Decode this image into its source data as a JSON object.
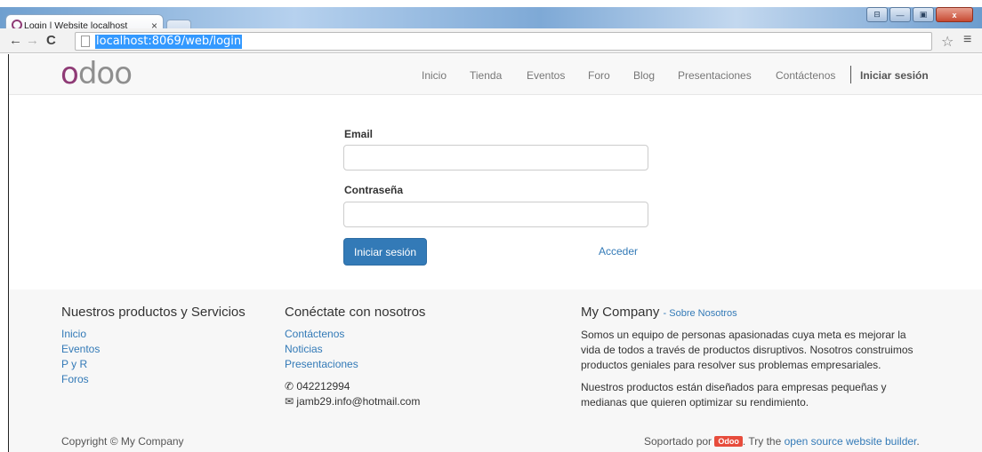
{
  "browser": {
    "tab_title": "Login | Website localhost",
    "tab_close": "×",
    "url": "localhost:8069/web/login",
    "back": "←",
    "forward": "→",
    "reload": "C",
    "star": "☆",
    "menu": "≡",
    "window_buttons": [
      "⊟",
      "—",
      "▣",
      "x"
    ]
  },
  "header": {
    "logo_first": "o",
    "logo_rest": "doo",
    "menu": [
      "Inicio",
      "Tienda",
      "Eventos",
      "Foro",
      "Blog",
      "Presentaciones",
      "Contáctenos"
    ],
    "signin": "Iniciar sesión"
  },
  "login": {
    "email_label": "Email",
    "email_value": "",
    "password_label": "Contraseña",
    "password_value": "",
    "submit_label": "Iniciar sesión",
    "acceder_label": "Acceder"
  },
  "footer": {
    "col1": {
      "title": "Nuestros productos y Servicios",
      "links": [
        "Inicio",
        "Eventos",
        "P y R",
        "Foros"
      ]
    },
    "col2": {
      "title": "Conéctate con nosotros",
      "links": [
        "Contáctenos",
        "Noticias",
        "Presentaciones"
      ],
      "phone": "042212994",
      "email": "jamb29.info@hotmail.com"
    },
    "col3": {
      "title": "My Company",
      "about_link": "- Sobre Nosotros",
      "para1_lines": [
        "Somos un equipo de personas apasionadas cuya meta es mejorar la",
        "vida de todos a través de productos disruptivos. Nosotros construimos",
        "productos geniales para resolver sus problemas empresariales."
      ],
      "para2_lines": [
        "Nuestros productos están diseñados para empresas pequeñas y",
        "medianas que quieren optimizar su rendimiento."
      ]
    },
    "copyright": "Copyright © My Company",
    "powered_prefix": "Soportado por",
    "powered_badge": "Odoo",
    "powered_middle": ". Try the",
    "powered_link": "open source website builder",
    "powered_suffix": "."
  },
  "colors": {
    "brand": "#8f3b76",
    "primary": "#337ab7",
    "link": "#337ab7",
    "badge": "#e74c3c"
  }
}
